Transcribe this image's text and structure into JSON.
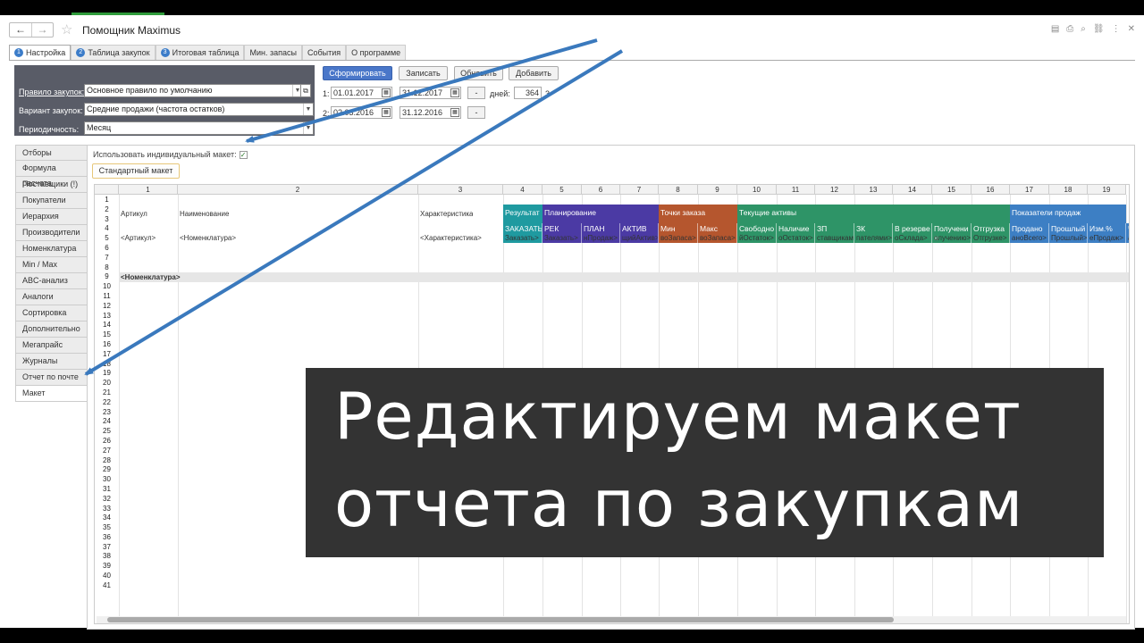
{
  "titlebar": {
    "back": "←",
    "forward": "→",
    "star": "☆",
    "title": "Помощник Maximus"
  },
  "right_icons": [
    "save-icon",
    "print-icon",
    "find-icon",
    "link-icon",
    "more-icon",
    "close-icon"
  ],
  "right_icon_glyphs": [
    "▤",
    "⎙",
    "⌕",
    "⛓",
    "⋮",
    "✕"
  ],
  "tabs": [
    {
      "num": "1",
      "label": "Настройка"
    },
    {
      "num": "2",
      "label": "Таблица закупок"
    },
    {
      "num": "3",
      "label": "Итоговая таблица"
    },
    {
      "num": "",
      "label": "Мин. запасы"
    },
    {
      "num": "",
      "label": "События"
    },
    {
      "num": "",
      "label": "О программе"
    }
  ],
  "params": {
    "rule_label": "Правило закупок:",
    "rule_value": "Основное правило по умолчанию",
    "variant_label": "Вариант закупок:",
    "variant_value": "Средние продажи (частота остатков)",
    "period_label": "Периодичность:",
    "period_value": "Месяц"
  },
  "buttons": {
    "form": "Сформировать",
    "save": "Записать",
    "update": "Обновить",
    "add": "Добавить"
  },
  "dates": {
    "n1": "1:",
    "d1a": "01.01.2017",
    "d1b": "31.12.2017",
    "n2": "2:",
    "d2a": "02.03.2016",
    "d2b": "31.12.2016",
    "minus": "-",
    "days_label": "дней:",
    "days": "364",
    "suffix": "3"
  },
  "sidebar": [
    "Отборы",
    "Формула расчета",
    "Поставщики (!)",
    "Покупатели",
    "Иерархия",
    "Производители",
    "Номенклатура",
    "Min / Max",
    "ABC-анализ",
    "Аналоги",
    "Сортировка",
    "Дополнительно",
    "Мегапрайс",
    "Журналы",
    "Отчет по почте",
    "Макет"
  ],
  "checkbox": {
    "label": "Использовать индивидуальный макет:",
    "mark": "✓"
  },
  "std_button": "Стандартный макет",
  "sheet": {
    "columns": [
      "1",
      "2",
      "3",
      "4",
      "5",
      "6",
      "7",
      "8",
      "9",
      "10",
      "11",
      "12",
      "13",
      "14",
      "15",
      "16",
      "17",
      "18",
      "19"
    ],
    "rows": [
      "1",
      "2",
      "3",
      "4",
      "5",
      "6",
      "7",
      "8",
      "9",
      "10",
      "11",
      "12",
      "13",
      "14",
      "15",
      "16",
      "17",
      "18",
      "19",
      "20",
      "21",
      "22",
      "23",
      "24",
      "25",
      "26",
      "27",
      "28",
      "29",
      "30",
      "31",
      "32",
      "33",
      "34",
      "35",
      "36",
      "37",
      "38",
      "39",
      "40",
      "41"
    ],
    "row23": {
      "article": "Артикул",
      "name": "Наименование",
      "char": "Характеристика"
    },
    "groups": [
      {
        "label": "Результат",
        "color": "#1f9aa0"
      },
      {
        "label": "Планирование",
        "color": "#4b3aa4"
      },
      {
        "label": "Точки заказа",
        "color": "#b5562e"
      },
      {
        "label": "Текущие активы",
        "color": "#2e9467"
      },
      {
        "label": "Показатели продаж",
        "color": "#3d7fc4"
      }
    ],
    "subheaders": [
      "ЗАКАЗАТЬ",
      "РЕК",
      "ПЛАН",
      "АКТИВ",
      "Мин",
      "Макс",
      "Свободно",
      "Наличие",
      "ЗП",
      "ЗК",
      "В резерве",
      "Получени е",
      "Отгрузка",
      "Продано",
      "Прошлый",
      "Изм.%",
      "Ч"
    ],
    "row5": [
      "<Артикул>",
      "<Номенклатура>",
      "<Характеристика>",
      "Заказать>",
      "Заказать>",
      "нПродаж>",
      "щийАктив>",
      "воЗапаса>",
      "воЗапаса>",
      "йОстаток>",
      "оОстаток>",
      "ставщикам>",
      "пателями>",
      "оСклада>",
      "олучению>",
      "Отгрузке>",
      "аноВсего>",
      "Прошлый>",
      "еПродаж>",
      "а"
    ],
    "row7": "<Номенклатура>"
  },
  "overlay": {
    "line1": "Редактируем макет",
    "line2": "отчета по закупкам"
  }
}
